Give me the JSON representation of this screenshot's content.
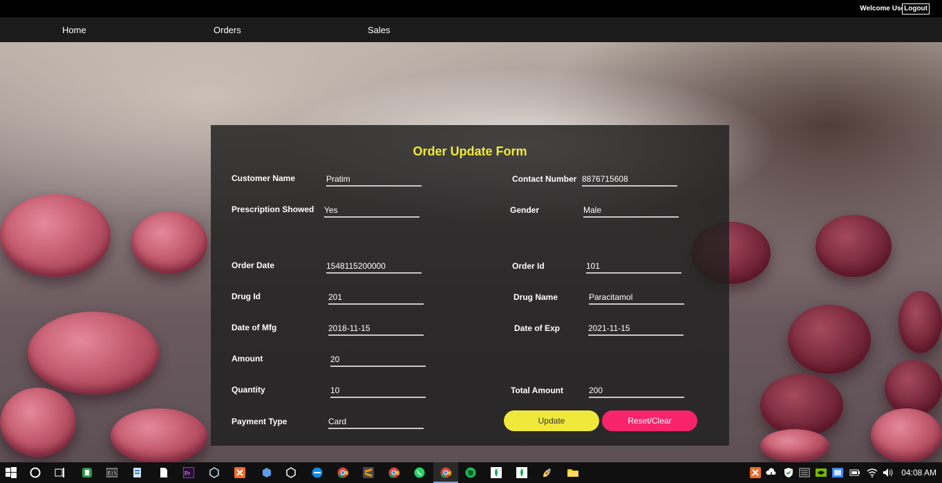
{
  "header": {
    "welcome": "Welcome User",
    "logout": "Logout"
  },
  "nav": {
    "home": "Home",
    "orders": "Orders",
    "sales": "Sales"
  },
  "form": {
    "title": "Order Update Form",
    "customer_name": {
      "label": "Customer Name",
      "value": "Pratim"
    },
    "contact_number": {
      "label": "Contact Number",
      "value": "8876715608"
    },
    "prescription_showed": {
      "label": "Prescription Showed",
      "value": "Yes"
    },
    "gender": {
      "label": "Gender",
      "value": "Male"
    },
    "order_date": {
      "label": "Order Date",
      "value": "1548115200000"
    },
    "order_id": {
      "label": "Order Id",
      "value": "101"
    },
    "drug_id": {
      "label": "Drug Id",
      "value": "201"
    },
    "drug_name": {
      "label": "Drug Name",
      "value": "Paracitamol"
    },
    "date_of_mfg": {
      "label": "Date of Mfg",
      "value": "2018-11-15"
    },
    "date_of_exp": {
      "label": "Date of Exp",
      "value": "2021-11-15"
    },
    "amount": {
      "label": "Amount",
      "value": "20"
    },
    "quantity": {
      "label": "Quantity",
      "value": "10"
    },
    "total_amount": {
      "label": "Total Amount",
      "value": "200"
    },
    "payment_type": {
      "label": "Payment Type",
      "value": "Card"
    },
    "update_button": "Update",
    "reset_button": "Reset/Clear"
  },
  "colors": {
    "title": "#f2ea3a",
    "update": "#f0e93c",
    "reset": "#f7246c"
  },
  "taskbar": {
    "icons": [
      "windows-start-icon",
      "cortana-circle-icon",
      "task-view-icon",
      "app-green-icon",
      "terminal-icon",
      "file-manager-icon",
      "notepad-icon",
      "premiere-icon",
      "cube-icon",
      "xampp-icon",
      "box-icon",
      "cube-outline-icon",
      "teamviewer-icon",
      "chrome-icon",
      "sublime-icon",
      "chrome-icon-2",
      "whatsapp-icon",
      "chrome-icon-3",
      "spotify-icon",
      "mongodb-icon",
      "mongodb-icon-2",
      "paint-icon",
      "folder-icon"
    ],
    "clock": "04:08 AM"
  }
}
